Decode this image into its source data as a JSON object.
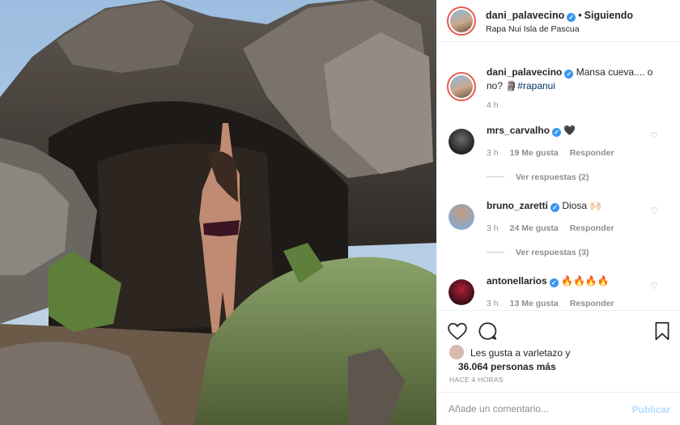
{
  "post": {
    "author": "dani_palavecino",
    "follow_status": "Siguiendo",
    "location": "Rapa Nui Isla de Pascua",
    "caption": "Mansa cueva.... o no? 🗿",
    "hashtag": "#rapanui",
    "caption_time": "4 h"
  },
  "comments": [
    {
      "user": "mrs_carvalho",
      "text": "🖤",
      "time": "3 h",
      "likes": "19 Me gusta",
      "reply": "Responder",
      "replies": "Ver respuestas (2)"
    },
    {
      "user": "bruno_zaretti",
      "text": "Diosa 🙌🏻",
      "time": "3 h",
      "likes": "24 Me gusta",
      "reply": "Responder",
      "replies": "Ver respuestas (3)"
    },
    {
      "user": "antonellarios",
      "text": "🔥🔥🔥🔥",
      "time": "3 h",
      "likes": "13 Me gusta",
      "reply": "Responder"
    }
  ],
  "likes": {
    "line1": "Les gusta a varletazo y",
    "line2": "36.064 personas más"
  },
  "posted_ago": "HACE 4 HORAS",
  "add_comment": {
    "placeholder": "Añade un comentario...",
    "publish_label": "Publicar"
  },
  "icons": [
    "heart-icon",
    "comment-icon",
    "bookmark-icon",
    "verified-icon"
  ],
  "colors": {
    "accent": "#3897f0",
    "link": "#003569",
    "muted": "#8e8e8e",
    "publish_disabled": "#b3dbff",
    "story_ring": "#e95950"
  }
}
